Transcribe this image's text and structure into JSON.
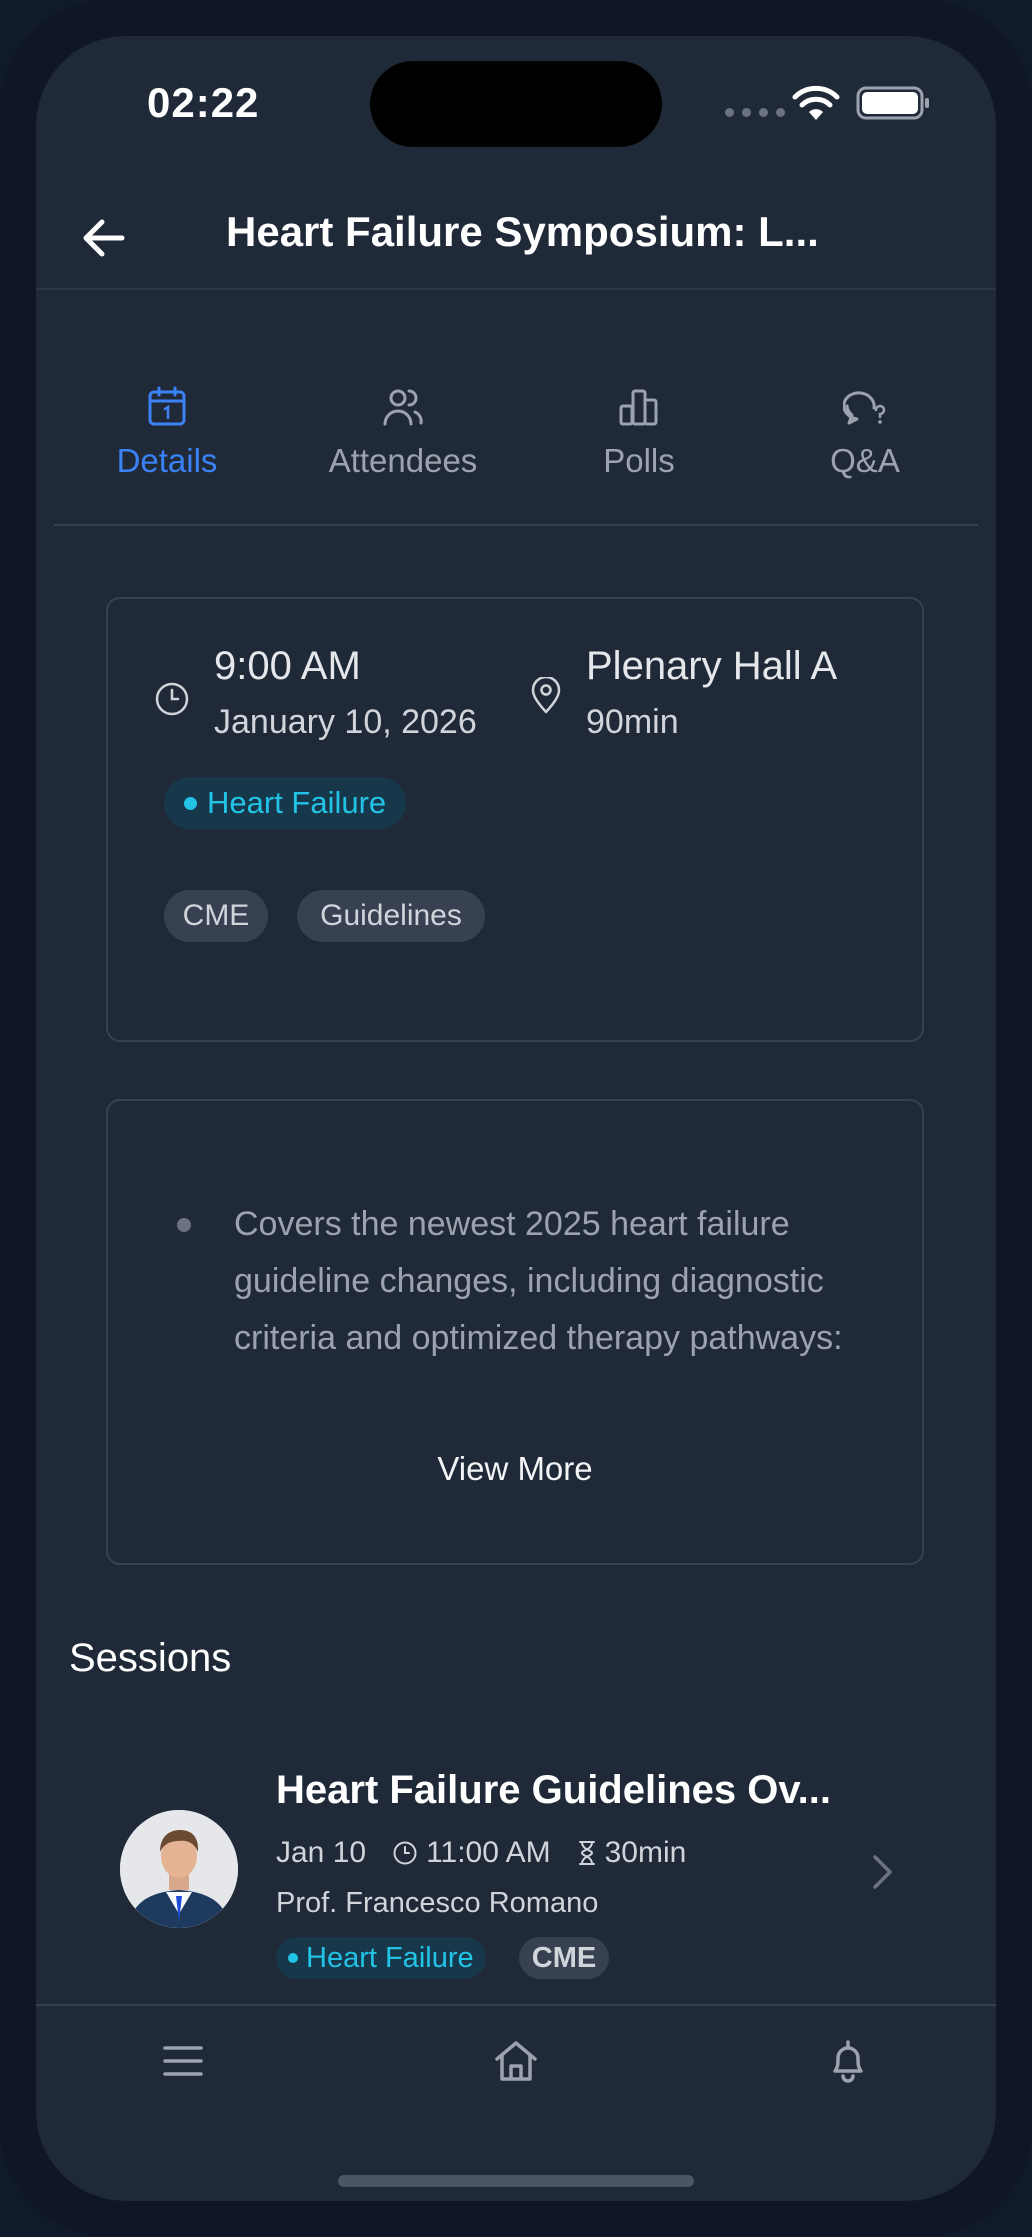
{
  "status_bar": {
    "time": "02:22"
  },
  "header": {
    "title": "Heart Failure Symposium: L..."
  },
  "tabs": [
    {
      "label": "Details",
      "icon": "calendar-icon",
      "active": true
    },
    {
      "label": "Attendees",
      "icon": "users-icon",
      "active": false
    },
    {
      "label": "Polls",
      "icon": "bar-chart-icon",
      "active": false
    },
    {
      "label": "Q&A",
      "icon": "chat-question-icon",
      "active": false
    }
  ],
  "info": {
    "time": "9:00 AM",
    "date": "January 10, 2026",
    "location": "Plenary Hall A",
    "duration": "90min",
    "topic": "Heart Failure",
    "tags": [
      "CME",
      "Guidelines"
    ]
  },
  "description": {
    "bullet": "Covers the newest 2025 heart failure guideline changes, including diagnostic criteria and optimized therapy pathways:",
    "view_more": "View More"
  },
  "sessions": {
    "title": "Sessions",
    "items": [
      {
        "title": "Heart Failure Guidelines Ov...",
        "date": "Jan 10",
        "time": "11:00 AM",
        "duration": "30min",
        "speaker": "Prof. Francesco Romano",
        "topic": "Heart Failure",
        "tag": "CME"
      }
    ]
  },
  "bottom_nav": [
    "menu-icon",
    "home-icon",
    "bell-icon"
  ],
  "colors": {
    "accent": "#3b82f6",
    "topic": "#22c3e6",
    "background": "#1f2937"
  }
}
